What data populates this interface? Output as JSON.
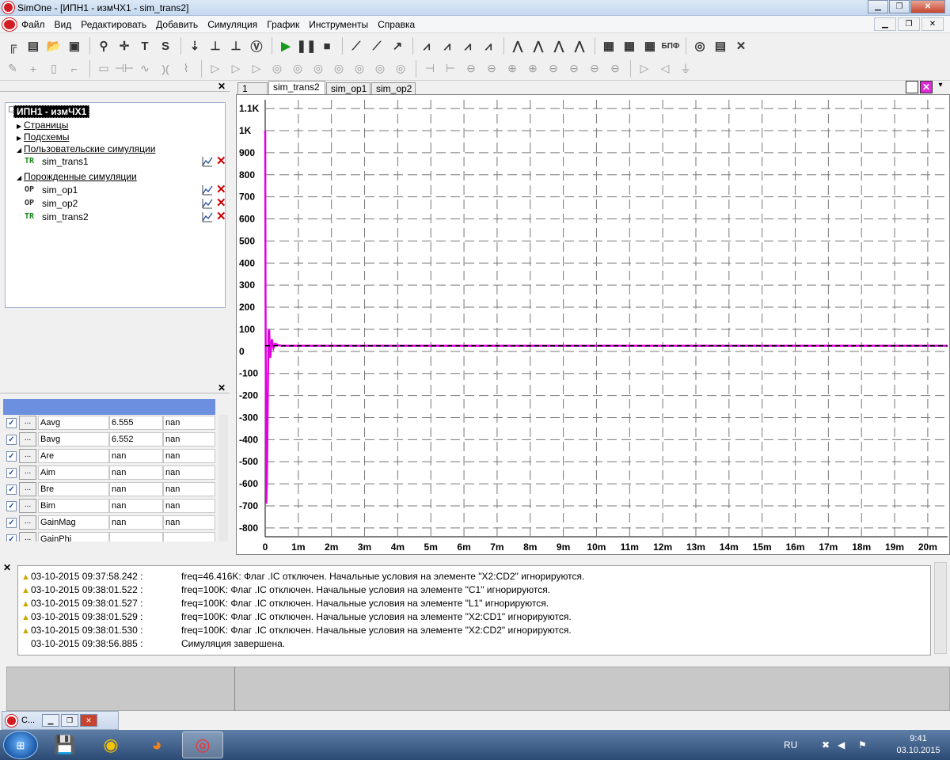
{
  "window": {
    "title": "SimOne - [ИПН1 - измЧХ1 - sim_trans2]"
  },
  "menu": {
    "items": [
      "Файл",
      "Вид",
      "Редактировать",
      "Добавить",
      "Симуляция",
      "График",
      "Инструменты",
      "Справка"
    ]
  },
  "toolbar1": {
    "buttons": [
      {
        "icon": "new-schematic-icon",
        "glyph": "╔"
      },
      {
        "icon": "spice-icon",
        "glyph": "▤"
      },
      {
        "icon": "open-folder-icon",
        "glyph": "📂"
      },
      {
        "icon": "save-icon",
        "glyph": "▣"
      },
      {
        "sep": true
      },
      {
        "icon": "zoom-icon",
        "glyph": "⚲"
      },
      {
        "icon": "crosshair-icon",
        "glyph": "✛"
      },
      {
        "icon": "text-icon",
        "glyph": "T"
      },
      {
        "icon": "s-icon",
        "glyph": "S"
      },
      {
        "sep": true
      },
      {
        "icon": "wire-x1-icon",
        "glyph": "⇣"
      },
      {
        "icon": "ground-icon",
        "glyph": "⊥"
      },
      {
        "icon": "ground2-icon",
        "glyph": "⊥"
      },
      {
        "icon": "voltage-source-icon",
        "glyph": "Ⓥ"
      },
      {
        "sep": true
      },
      {
        "icon": "run-simulation-icon",
        "glyph": "▶"
      },
      {
        "icon": "pause-icon",
        "glyph": "❚❚"
      },
      {
        "icon": "stop-icon",
        "glyph": "■"
      },
      {
        "sep": true
      },
      {
        "icon": "plot-icon",
        "glyph": "⟋"
      },
      {
        "icon": "add-plot-icon",
        "glyph": "⟋"
      },
      {
        "icon": "probe-icon",
        "glyph": "↗"
      },
      {
        "sep": true
      },
      {
        "icon": "wave1-icon",
        "glyph": "⩘"
      },
      {
        "icon": "wave2-icon",
        "glyph": "⩘"
      },
      {
        "icon": "wave3-icon",
        "glyph": "⩘"
      },
      {
        "icon": "wave4-icon",
        "glyph": "⩘"
      },
      {
        "sep": true
      },
      {
        "icon": "fft1-icon",
        "glyph": "⋀"
      },
      {
        "icon": "fft2-icon",
        "glyph": "⋀"
      },
      {
        "icon": "fft3-icon",
        "glyph": "⋀"
      },
      {
        "icon": "fft4-icon",
        "glyph": "⋀"
      },
      {
        "sep": true
      },
      {
        "icon": "calculator-icon",
        "glyph": "▦"
      },
      {
        "icon": "table-icon",
        "glyph": "▦"
      },
      {
        "icon": "grid-icon",
        "glyph": "▦"
      },
      {
        "icon": "bpf-icon",
        "glyph": "БПФ"
      },
      {
        "sep": true
      },
      {
        "icon": "glasses-icon",
        "glyph": "◎"
      },
      {
        "icon": "report-icon",
        "glyph": "▤"
      },
      {
        "icon": "tools-icon",
        "glyph": "✕"
      }
    ]
  },
  "toolbar2": {
    "buttons": [
      {
        "icon": "pencil-icon",
        "glyph": "✎"
      },
      {
        "icon": "plus-icon",
        "glyph": "+"
      },
      {
        "icon": "component-icon",
        "glyph": "▯"
      },
      {
        "icon": "step-icon",
        "glyph": "⌐"
      },
      {
        "sep": true
      },
      {
        "icon": "resistor-icon",
        "glyph": "▭"
      },
      {
        "icon": "capacitor-icon",
        "glyph": "⊣⊢"
      },
      {
        "icon": "inductor-icon",
        "glyph": "∿"
      },
      {
        "icon": "transformer-icon",
        "glyph": ")("
      },
      {
        "icon": "coupled-icon",
        "glyph": "⌇"
      },
      {
        "sep": true
      },
      {
        "icon": "diode-icon",
        "glyph": "▷"
      },
      {
        "icon": "zener-icon",
        "glyph": "▷"
      },
      {
        "icon": "diode3-icon",
        "glyph": "▷"
      },
      {
        "icon": "diode4-icon",
        "glyph": "◎"
      },
      {
        "icon": "bjt-npn-icon",
        "glyph": "◎"
      },
      {
        "icon": "bjt-pnp-icon",
        "glyph": "◎"
      },
      {
        "icon": "jfet-icon",
        "glyph": "◎"
      },
      {
        "icon": "mosfet-icon",
        "glyph": "◎"
      },
      {
        "icon": "mosfet2-icon",
        "glyph": "◎"
      },
      {
        "icon": "igbt-icon",
        "glyph": "◎"
      },
      {
        "sep": true
      },
      {
        "icon": "switch-icon",
        "glyph": "⊣"
      },
      {
        "icon": "switch2-icon",
        "glyph": "⊢"
      },
      {
        "icon": "source1-icon",
        "glyph": "⊖"
      },
      {
        "icon": "source2-icon",
        "glyph": "⊖"
      },
      {
        "icon": "source3-icon",
        "glyph": "⊕"
      },
      {
        "icon": "source4-icon",
        "glyph": "⊕"
      },
      {
        "icon": "source5-icon",
        "glyph": "⊖"
      },
      {
        "icon": "source6-icon",
        "glyph": "⊖"
      },
      {
        "icon": "source7-icon",
        "glyph": "⊖"
      },
      {
        "icon": "source8-icon",
        "glyph": "⊖"
      },
      {
        "sep": true
      },
      {
        "icon": "port-in-icon",
        "glyph": "▷"
      },
      {
        "icon": "port-out-icon",
        "glyph": "◁"
      },
      {
        "icon": "gnd-icon",
        "glyph": "⏚"
      }
    ]
  },
  "tree": {
    "root": "ИПН1 - измЧХ1",
    "nodes": [
      {
        "label": "Страницы",
        "expanded": false
      },
      {
        "label": "Подсхемы",
        "expanded": false
      },
      {
        "label": "Пользовательские симуляции",
        "expanded": true
      }
    ],
    "user_sims": [
      {
        "tag": "TR",
        "name": "sim_trans1"
      }
    ],
    "generated_label": "Порожденные симуляции",
    "generated_sims": [
      {
        "tag": "OP",
        "name": "sim_op1"
      },
      {
        "tag": "OP",
        "name": "sim_op2"
      },
      {
        "tag": "TR",
        "name": "sim_trans2"
      }
    ]
  },
  "measurements": {
    "rows": [
      {
        "checked": true,
        "name": "Aavg",
        "v1": "6.555",
        "v2": "nan"
      },
      {
        "checked": true,
        "name": "Bavg",
        "v1": "6.552",
        "v2": "nan"
      },
      {
        "checked": true,
        "name": "Are",
        "v1": "nan",
        "v2": "nan"
      },
      {
        "checked": true,
        "name": "Aim",
        "v1": "nan",
        "v2": "nan"
      },
      {
        "checked": true,
        "name": "Bre",
        "v1": "nan",
        "v2": "nan"
      },
      {
        "checked": true,
        "name": "Bim",
        "v1": "nan",
        "v2": "nan"
      },
      {
        "checked": true,
        "name": "GainMag",
        "v1": "nan",
        "v2": "nan"
      },
      {
        "checked": true,
        "name": "GainPhi",
        "v1": "",
        "v2": ""
      }
    ]
  },
  "plot_tabs": {
    "tabs": [
      "1",
      "sim_trans2",
      "sim_op1",
      "sim_op2"
    ],
    "active": 1
  },
  "chart_data": {
    "type": "line",
    "x_ticks": [
      "0",
      "1m",
      "2m",
      "3m",
      "4m",
      "5m",
      "6m",
      "7m",
      "8m",
      "9m",
      "10m",
      "11m",
      "12m",
      "13m",
      "14m",
      "15m",
      "16m",
      "17m",
      "18m",
      "19m",
      "20m"
    ],
    "y_ticks": [
      "1.1K",
      "1K",
      "900",
      "800",
      "700",
      "600",
      "500",
      "400",
      "300",
      "200",
      "100",
      "0",
      "-100",
      "-200",
      "-300",
      "-400",
      "-500",
      "-600",
      "-700",
      "-800"
    ],
    "xlim": [
      0,
      0.0206
    ],
    "ylim": [
      -840,
      1140
    ],
    "grid": true,
    "series": [
      {
        "color": "#e000e0",
        "x": [
          0,
          1e-05,
          3e-05,
          5e-05,
          0.0001,
          0.00012,
          0.00015,
          0.0002,
          0.00025,
          0.0003,
          0.0004,
          0.0005,
          0.0008,
          0.001,
          0.005,
          0.01,
          0.015,
          0.0206
        ],
        "y": [
          1000,
          250,
          -690,
          -600,
          90,
          100,
          -30,
          55,
          15,
          35,
          28,
          25,
          25,
          25,
          25,
          25,
          25,
          25
        ]
      },
      {
        "color": "#000000",
        "dashed": true,
        "x": [
          0,
          0.0206
        ],
        "y": [
          25,
          25
        ]
      }
    ]
  },
  "log": {
    "lines": [
      {
        "warn": true,
        "ts": "03-10-2015 09:37:58.242 :",
        "msg": "freq=46.416K: Флаг .IC отключен. Начальные условия на элементе \"X2:CD2\" игнорируются."
      },
      {
        "warn": true,
        "ts": "03-10-2015 09:38:01.522 :",
        "msg": "freq=100K: Флаг .IC отключен. Начальные условия на элементе \"C1\" игнорируются."
      },
      {
        "warn": true,
        "ts": "03-10-2015 09:38:01.527 :",
        "msg": "freq=100K: Флаг .IC отключен. Начальные условия на элементе \"L1\" игнорируются."
      },
      {
        "warn": true,
        "ts": "03-10-2015 09:38:01.529 :",
        "msg": "freq=100K: Флаг .IC отключен. Начальные условия на элементе \"X2:CD1\" игнорируются."
      },
      {
        "warn": true,
        "ts": "03-10-2015 09:38:01.530 :",
        "msg": "freq=100K: Флаг .IC отключен. Начальные условия на элементе \"X2:CD2\" игнорируются."
      },
      {
        "warn": false,
        "ts": "03-10-2015 09:38:56.885 :",
        "msg": "Симуляция завершена."
      }
    ]
  },
  "minimized_child": {
    "label": "C..."
  },
  "taskbar": {
    "apps": [
      {
        "icon": "save-disk-icon",
        "glyph": "💾"
      },
      {
        "icon": "chrome-icon",
        "glyph": "◉"
      },
      {
        "icon": "firefox-icon",
        "glyph": "◕"
      },
      {
        "icon": "simone-icon",
        "glyph": "◎"
      }
    ],
    "lang": "RU",
    "time": "9:41",
    "date": "03.10.2015"
  },
  "colors": {
    "magenta_trace": "#e000e0",
    "accent_blue": "#6d8fe0",
    "brand_red": "#d21d24"
  }
}
